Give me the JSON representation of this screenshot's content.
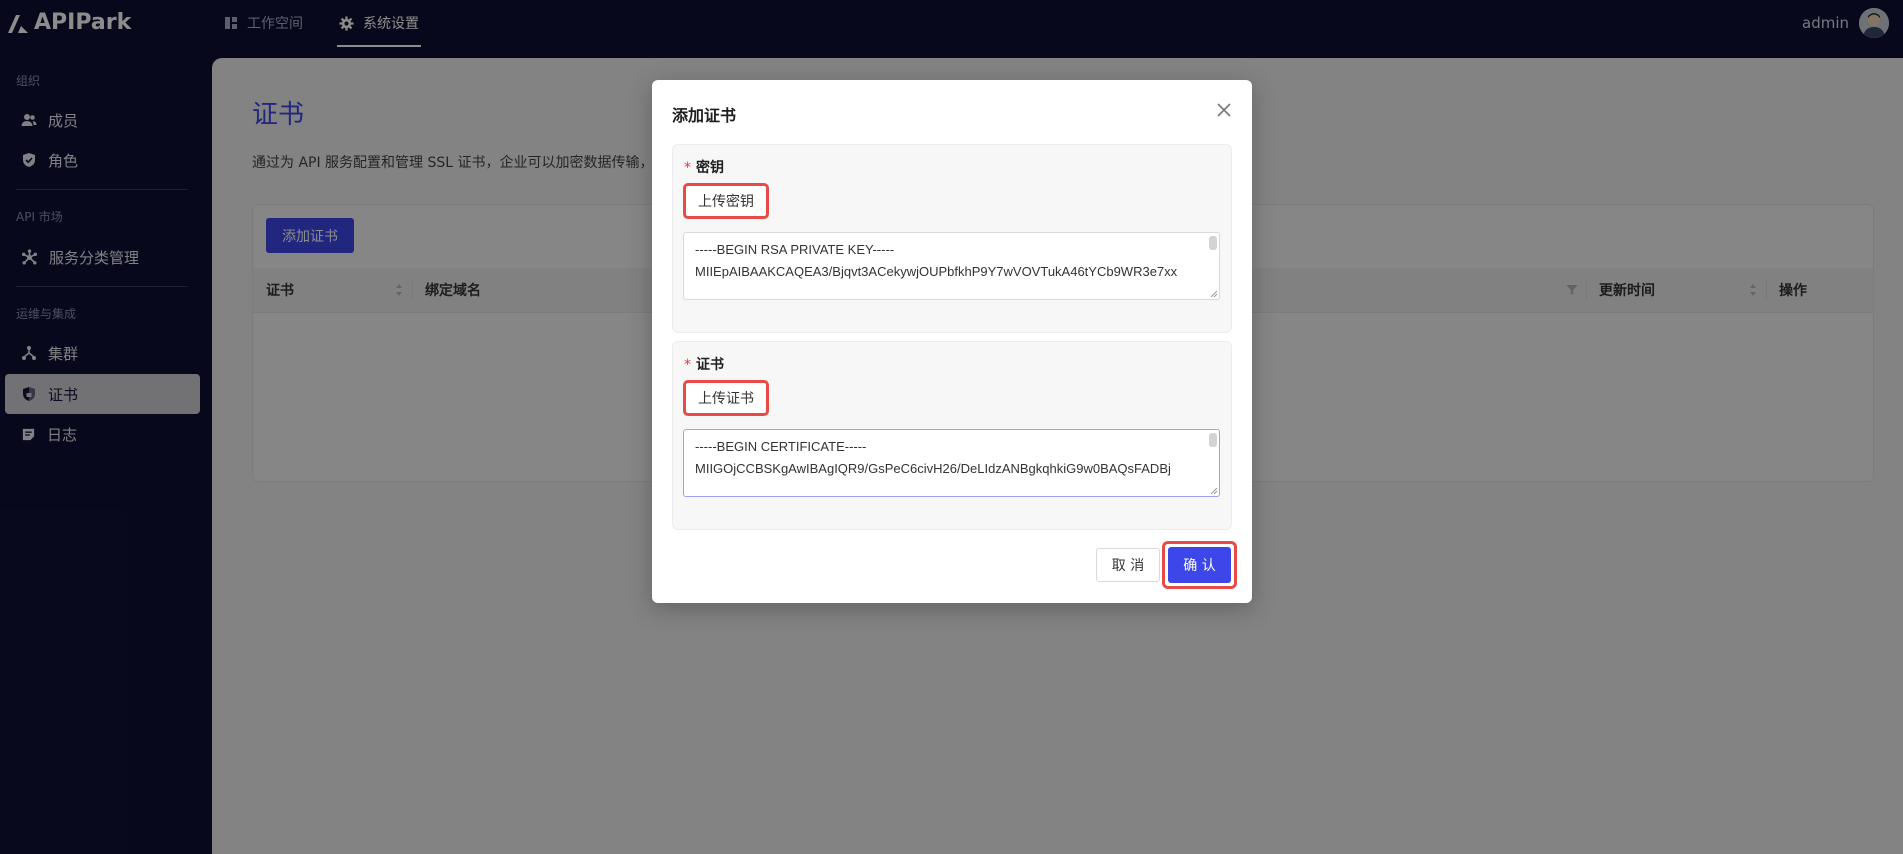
{
  "app": {
    "logo_text": "APIPark"
  },
  "topnav": [
    {
      "label": "工作空间",
      "icon": "dashboard-icon",
      "active": false
    },
    {
      "label": "系统设置",
      "icon": "gear-icon",
      "active": true
    }
  ],
  "user": {
    "name": "admin"
  },
  "sidebar": {
    "sections": [
      {
        "title": "组织",
        "items": [
          {
            "label": "成员",
            "icon": "users-icon"
          },
          {
            "label": "角色",
            "icon": "shield-check-icon"
          }
        ]
      },
      {
        "title": "API 市场",
        "items": [
          {
            "label": "服务分类管理",
            "icon": "network-icon"
          }
        ]
      },
      {
        "title": "运维与集成",
        "items": [
          {
            "label": "集群",
            "icon": "cluster-icon"
          },
          {
            "label": "证书",
            "icon": "shield-lock-icon",
            "active": true
          },
          {
            "label": "日志",
            "icon": "log-icon"
          }
        ]
      }
    ]
  },
  "page": {
    "title": "证书",
    "description": "通过为 API 服务配置和管理 SSL 证书，企业可以加密数据传输，",
    "add_button": "添加证书",
    "table": {
      "columns": [
        "证书",
        "绑定域名",
        "更新时间",
        "操作"
      ]
    }
  },
  "modal": {
    "title": "添加证书",
    "key_field": {
      "label": "密钥",
      "upload_button": "上传密钥",
      "value": "-----BEGIN RSA PRIVATE KEY-----\nMIIEpAIBAAKCAQEA3/Bjqvt3ACekywjOUPbfkhP9Y7wVOVTukA46tYCb9WR3e7xx"
    },
    "cert_field": {
      "label": "证书",
      "upload_button": "上传证书",
      "value": "-----BEGIN CERTIFICATE-----\nMIIGOjCCBSKgAwIBAgIQR9/GsPeC6civH26/DeLIdzANBgkqhkiG9w0BAQsFADBj"
    },
    "cancel_button": "取 消",
    "confirm_button": "确 认"
  },
  "colors": {
    "brand": "#3d46e8",
    "highlight": "#e84a46",
    "sidebar_bg": "#0f1033"
  }
}
